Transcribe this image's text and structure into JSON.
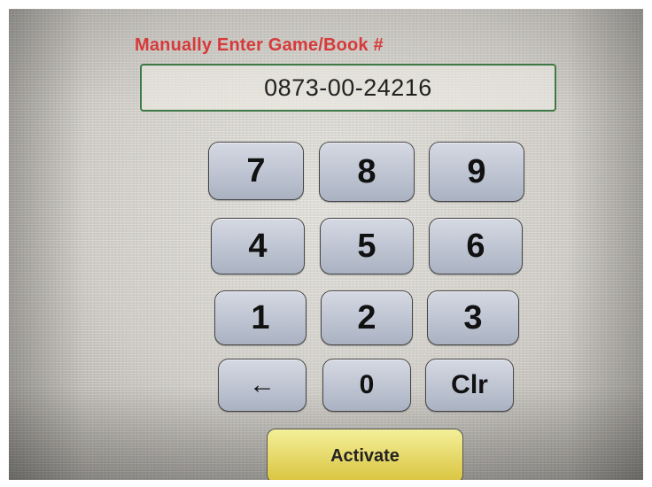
{
  "entry": {
    "label": "Manually Enter Game/Book #",
    "value": "0873-00-24216"
  },
  "keypad": {
    "k7": "7",
    "k8": "8",
    "k9": "9",
    "k4": "4",
    "k5": "5",
    "k6": "6",
    "k1": "1",
    "k2": "2",
    "k3": "3",
    "back": "←",
    "k0": "0",
    "clear": "Clr"
  },
  "actions": {
    "activate_label": "Activate"
  },
  "colors": {
    "label": "#d63a3a",
    "field_border": "#3e7a45",
    "key_fill": "#b8bfcc",
    "activate_fill": "#e3d055"
  }
}
